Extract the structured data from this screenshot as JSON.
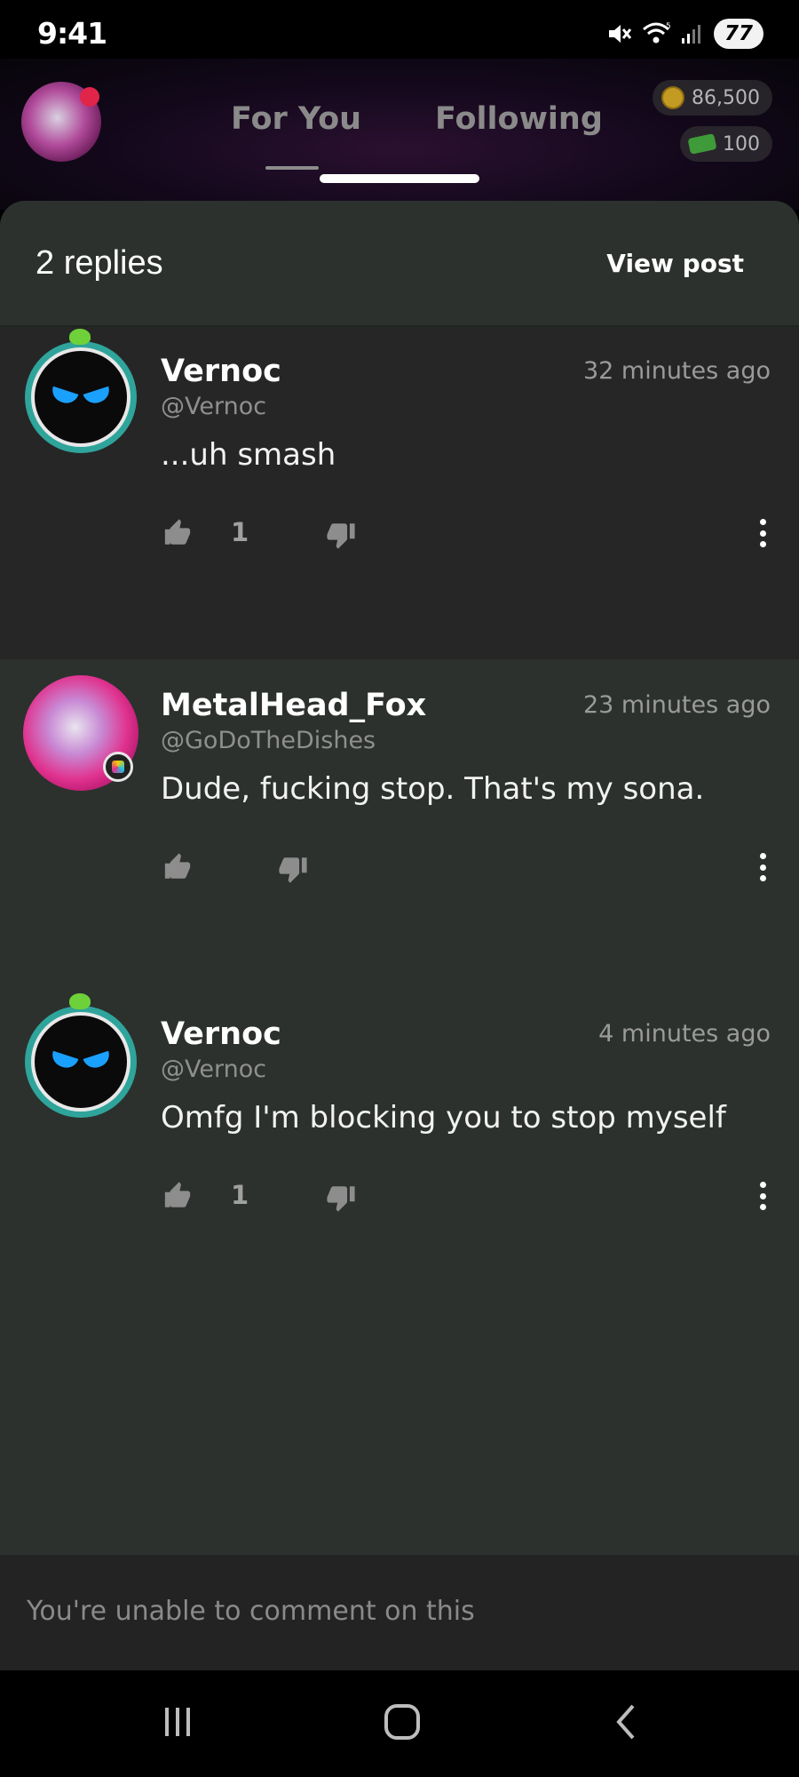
{
  "status_bar": {
    "time": "9:41",
    "battery": "77",
    "icons": [
      "mute-icon",
      "wifi-icon",
      "signal-icon",
      "battery-icon"
    ]
  },
  "header": {
    "tabs": [
      {
        "label": "For You"
      },
      {
        "label": "Following"
      }
    ],
    "currencies": [
      {
        "icon": "coin-icon",
        "value": "86,500"
      },
      {
        "icon": "cash-icon",
        "value": "100"
      }
    ]
  },
  "thread": {
    "title": "2 replies",
    "view_post_label": "View post"
  },
  "replies": [
    {
      "name": "Vernoc",
      "handle": "@Vernoc",
      "time": "32 minutes ago",
      "text": "...uh smash",
      "likes": "1"
    },
    {
      "name": "MetalHead_Fox",
      "handle": "@GoDoTheDishes",
      "time": "23 minutes ago",
      "text": "Dude, fucking stop. That's my sona.",
      "likes": ""
    },
    {
      "name": "Vernoc",
      "handle": "@Vernoc",
      "time": "4 minutes ago",
      "text": "Omfg I'm blocking you to stop myself",
      "likes": "1"
    }
  ],
  "comment_bar": {
    "disabled_text": "You're unable to comment on this"
  },
  "colors": {
    "panel": "#2c312d",
    "highlight_row": "#262626",
    "avatar_ring": "#2fa49b",
    "eye_blue": "#1aa0ff"
  }
}
